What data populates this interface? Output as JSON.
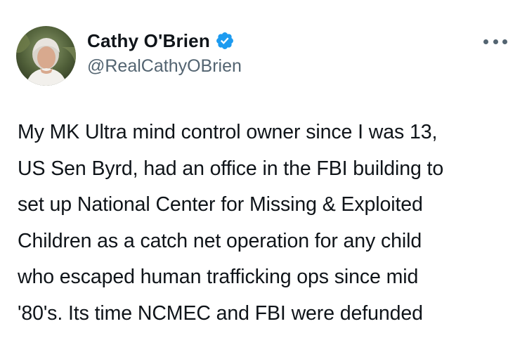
{
  "author": {
    "display_name": "Cathy O'Brien",
    "handle": "@RealCathyOBrien",
    "verified": true,
    "avatar_icon": "profile-photo"
  },
  "menu": {
    "icon": "more-options-icon"
  },
  "tweet": {
    "lines": [
      "My MK Ultra mind control owner since I was 13,",
      "US Sen Byrd, had an office in the FBI building to",
      "set up National Center for Missing & Exploited",
      "Children as a catch net operation for any child",
      "who escaped human trafficking ops since mid",
      "'80's. Its time NCMEC and FBI were defunded"
    ]
  },
  "colors": {
    "text": "#0f1419",
    "secondary": "#536471",
    "verified_badge": "#1d9bf0",
    "background": "#ffffff"
  }
}
